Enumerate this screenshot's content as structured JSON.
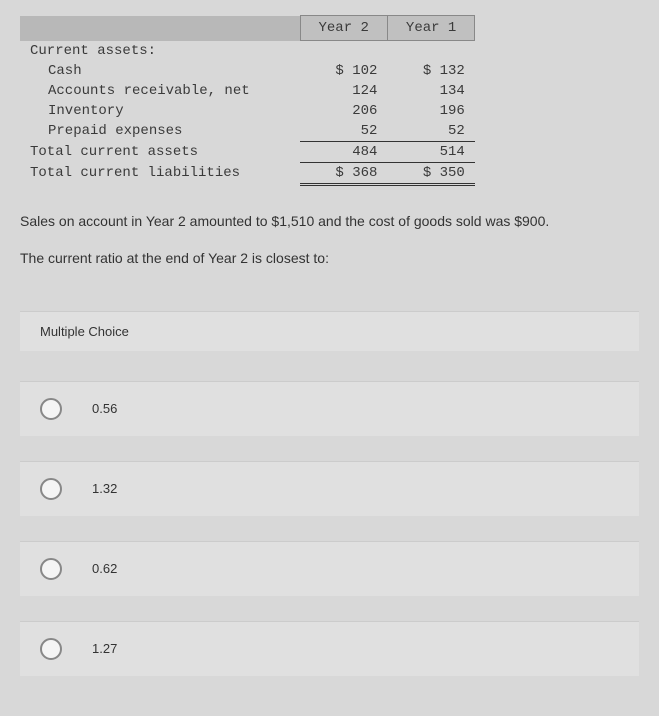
{
  "table": {
    "headers": {
      "col1": "Year 2",
      "col2": "Year 1"
    },
    "section_header": "Current assets:",
    "rows": [
      {
        "label": "Cash",
        "y2": "$ 102",
        "y1": "$ 132"
      },
      {
        "label": "Accounts receivable, net",
        "y2": "124",
        "y1": "134"
      },
      {
        "label": "Inventory",
        "y2": "206",
        "y1": "196"
      },
      {
        "label": "Prepaid expenses",
        "y2": "52",
        "y1": "52"
      }
    ],
    "total_ca": {
      "label": "Total current assets",
      "y2": "484",
      "y1": "514"
    },
    "total_cl": {
      "label": "Total current liabilities",
      "y2": "$ 368",
      "y1": "$ 350"
    }
  },
  "question": "Sales on account in Year 2 amounted to $1,510 and the cost of goods sold was $900.",
  "prompt": "The current ratio at the end of Year 2 is closest to:",
  "mc_header": "Multiple Choice",
  "options": [
    {
      "label": "0.56"
    },
    {
      "label": "1.32"
    },
    {
      "label": "0.62"
    },
    {
      "label": "1.27"
    }
  ],
  "chart_data": {
    "type": "table",
    "title": "Balance Sheet Extract (Current Assets / Liabilities)",
    "columns": [
      "Item",
      "Year 2",
      "Year 1"
    ],
    "rows": [
      [
        "Cash",
        102,
        132
      ],
      [
        "Accounts receivable, net",
        124,
        134
      ],
      [
        "Inventory",
        206,
        196
      ],
      [
        "Prepaid expenses",
        52,
        52
      ],
      [
        "Total current assets",
        484,
        514
      ],
      [
        "Total current liabilities",
        368,
        350
      ]
    ],
    "additional": {
      "sales_on_account_year2": 1510,
      "cogs_year2": 900
    }
  }
}
